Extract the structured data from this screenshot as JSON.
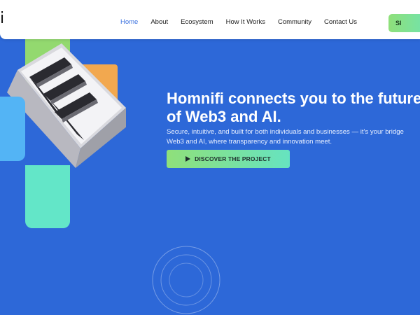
{
  "header": {
    "logo_fragment": "i",
    "nav": [
      {
        "label": "Home",
        "active": true
      },
      {
        "label": "About",
        "active": false
      },
      {
        "label": "Ecosystem",
        "active": false
      },
      {
        "label": "How It Works",
        "active": false
      },
      {
        "label": "Community",
        "active": false
      },
      {
        "label": "Contact Us",
        "active": false
      }
    ],
    "cta_label": "SI",
    "nav_active_color": "#3d73df"
  },
  "hero": {
    "title_line1": "Homnifi connects you to the future",
    "title_line2": "of Web3 and AI.",
    "subtitle_line1": "Secure, intuitive, and built for both individuals and businesses — it's your bridge",
    "subtitle_line2": "Web3 and AI, where transparency and innovation meet.",
    "button_label": "DISCOVER THE PROJECT",
    "button_icon": "play-icon"
  },
  "colors": {
    "background": "#2d68d8",
    "accent_green": "#8fe07a",
    "accent_teal": "#66e3c0",
    "accent_orange": "#f2a84f",
    "accent_lightblue": "#53b4f5"
  }
}
